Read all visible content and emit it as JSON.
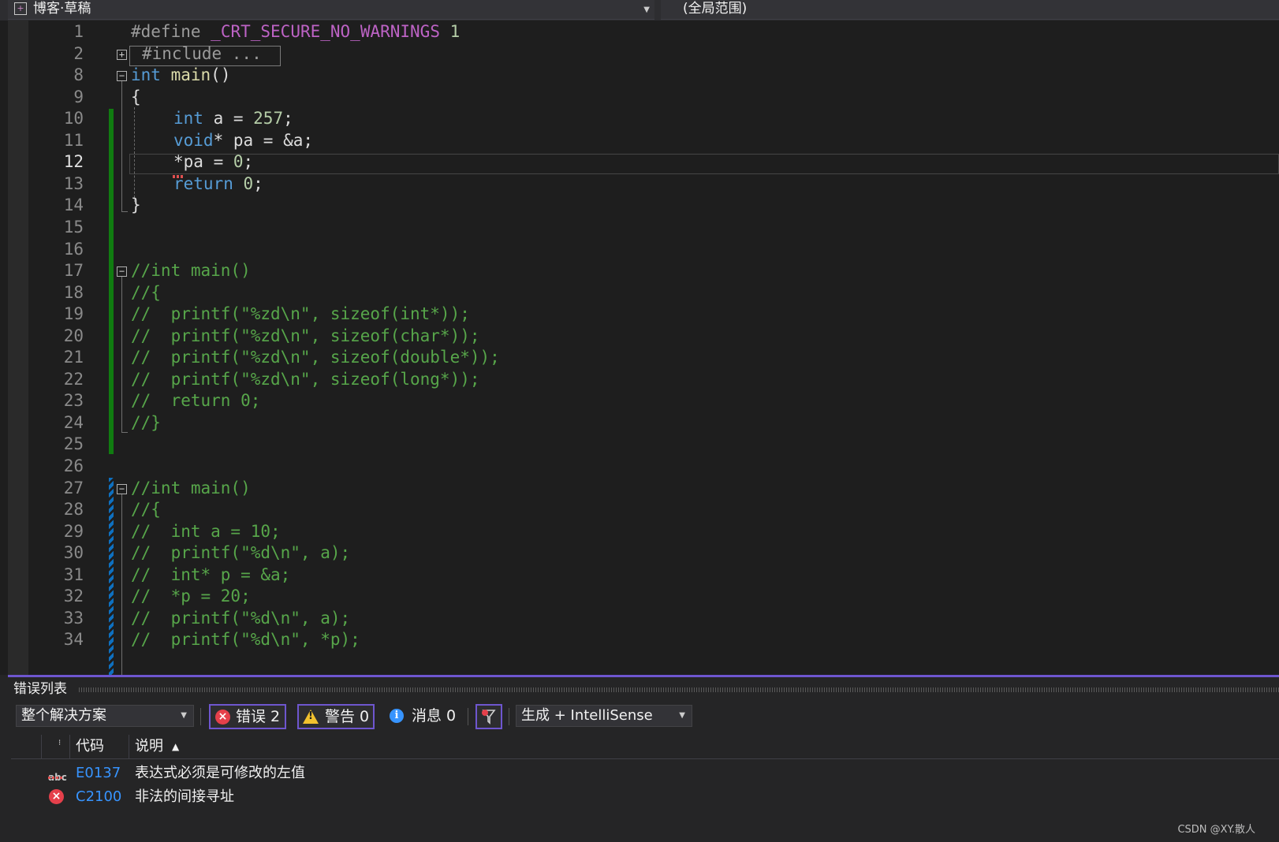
{
  "navbar": {
    "project": "博客·草稿",
    "scope": "(全局范围)"
  },
  "editor": {
    "lines": [
      {
        "n": "1"
      },
      {
        "n": "2"
      },
      {
        "n": "8"
      },
      {
        "n": "9"
      },
      {
        "n": "10"
      },
      {
        "n": "11"
      },
      {
        "n": "12"
      },
      {
        "n": "13"
      },
      {
        "n": "14"
      },
      {
        "n": "15"
      },
      {
        "n": "16"
      },
      {
        "n": "17"
      },
      {
        "n": "18"
      },
      {
        "n": "19"
      },
      {
        "n": "20"
      },
      {
        "n": "21"
      },
      {
        "n": "22"
      },
      {
        "n": "23"
      },
      {
        "n": "24"
      },
      {
        "n": "25"
      },
      {
        "n": "26"
      },
      {
        "n": "27"
      },
      {
        "n": "28"
      },
      {
        "n": "29"
      },
      {
        "n": "30"
      },
      {
        "n": "31"
      },
      {
        "n": "32"
      },
      {
        "n": "33"
      },
      {
        "n": "34"
      }
    ],
    "current_line": "12",
    "code": {
      "l1": {
        "directive": "#define",
        "macro": "_CRT_SECURE_NO_WARNINGS",
        "value": "1"
      },
      "l2": "#include ...",
      "l8": {
        "kw": "int",
        "name": "main",
        "rest": "()"
      },
      "l9": "{",
      "l10": {
        "kw": "int",
        "rest_a": " a = ",
        "num": "257",
        "end": ";"
      },
      "l11": {
        "kw": "void",
        "rest": "* pa = &a;"
      },
      "l12": {
        "star": "*",
        "rest": "pa = ",
        "num": "0",
        "end": ";"
      },
      "l13": {
        "kw": "return",
        "rest": " ",
        "num": "0",
        "end": ";"
      },
      "l14": "}",
      "l17": "//int main()",
      "l18": "//{",
      "l19": "//  printf(\"%zd\\n\", sizeof(int*));",
      "l20": "//  printf(\"%zd\\n\", sizeof(char*));",
      "l21": "//  printf(\"%zd\\n\", sizeof(double*));",
      "l22": "//  printf(\"%zd\\n\", sizeof(long*));",
      "l23": "//  return 0;",
      "l24": "//}",
      "l27": "//int main()",
      "l28": "//{",
      "l29": "//  int a = 10;",
      "l30": "//  printf(\"%d\\n\", a);",
      "l31": "//  int* p = &a;",
      "l32": "//  *p = 20;",
      "l33": "//  printf(\"%d\\n\", a);",
      "l34": "//  printf(\"%d\\n\", *p);"
    }
  },
  "error_list": {
    "title": "错误列表",
    "scope_combo": "整个解决方案",
    "errors_label": "错误 2",
    "warnings_label": "警告 0",
    "messages_label": "消息 0",
    "source_combo": "生成 + IntelliSense",
    "columns": {
      "code": "代码",
      "description": "说明"
    },
    "rows": [
      {
        "code": "E0137",
        "description": "表达式必须是可修改的左值",
        "icon": "intellisense-abc-icon"
      },
      {
        "code": "C2100",
        "description": "非法的间接寻址",
        "icon": "error-circle-icon"
      }
    ]
  },
  "watermark": "CSDN @XY.散人",
  "colors": {
    "keyword": "#569cd6",
    "comment": "#57a64a",
    "number": "#b5cea8",
    "function": "#dcdcaa",
    "accent": "#6e56cf",
    "change_saved": "#107c10",
    "change_unsaved": "#0e70c0",
    "error": "#e5404b"
  }
}
